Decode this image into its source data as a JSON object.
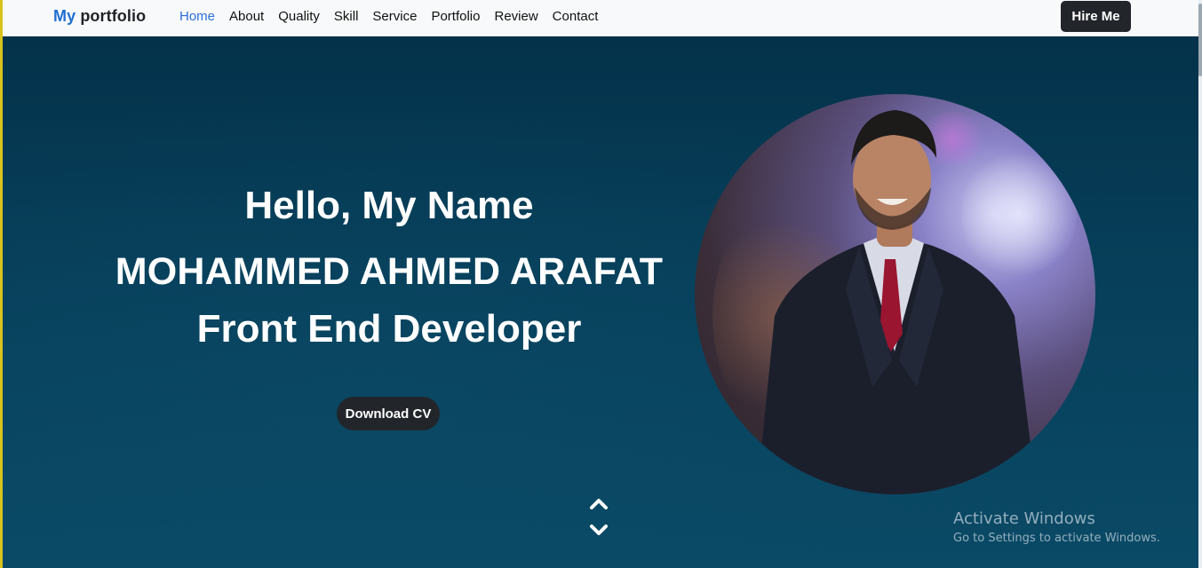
{
  "navbar": {
    "brand_accent": "My",
    "brand_rest": "portfolio",
    "links": [
      "Home",
      "About",
      "Quality",
      "Skill",
      "Service",
      "Portfolio",
      "Review",
      "Contact"
    ],
    "active_link": "Home",
    "hire_label": "Hire Me"
  },
  "hero": {
    "greeting": "Hello, My Name",
    "name": "MOHAMMED AHMED ARAFAT",
    "role": "Front End Developer",
    "cv_label": "Download CV",
    "portrait_icon": "profile-photo",
    "scroll_icon": "chevron-up-down-icon"
  },
  "watermark": {
    "title": "Activate Windows",
    "subtitle": "Go to Settings to activate Windows."
  },
  "colors": {
    "hero_bg": "#073f5a",
    "accent": "#1f6fd1",
    "button_dark": "#22262b"
  }
}
